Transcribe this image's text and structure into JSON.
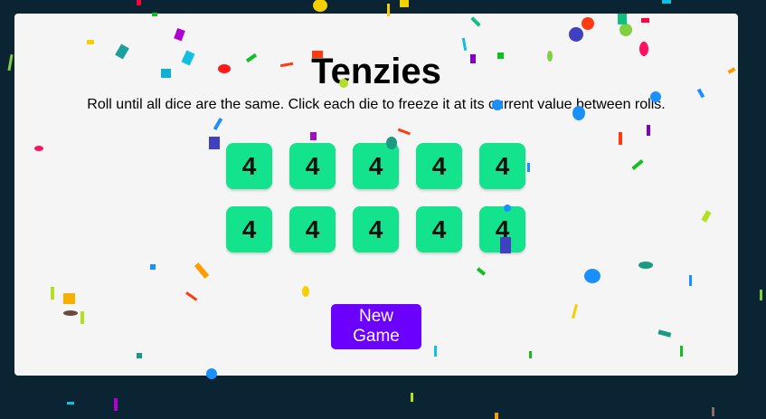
{
  "game": {
    "title": "Tenzies",
    "instructions": "Roll until all dice are the same. Click each die to freeze it at its current value between rolls.",
    "dice": [
      "4",
      "4",
      "4",
      "4",
      "4",
      "4",
      "4",
      "4",
      "4",
      "4"
    ],
    "new_game_label": "New Game"
  },
  "colors": {
    "background": "#0b2434",
    "card": "#f5f5f5",
    "die": "#12e38c",
    "button": "#6b00ff"
  }
}
